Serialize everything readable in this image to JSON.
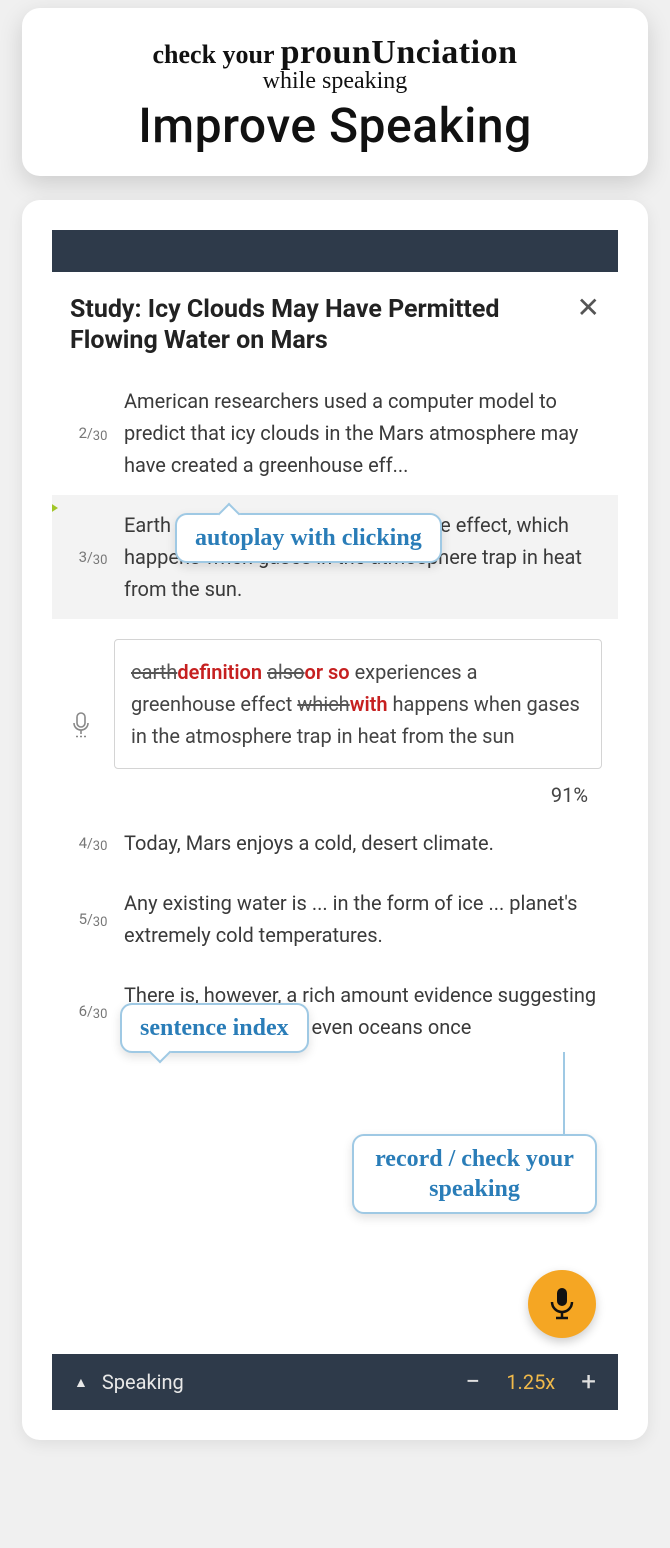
{
  "promo": {
    "line1_a": "check your",
    "line1_b": "prounUnciation",
    "line2": "while speaking",
    "line3": "Improve Speaking"
  },
  "article": {
    "title": "Study: Icy Clouds May Have Permitted Flowing Water on Mars",
    "total": "30",
    "sentences": [
      {
        "idx": "2",
        "text": "American researchers used a computer model to predict that icy clouds in the Mars atmosphere may have created a greenhouse eff..."
      },
      {
        "idx": "3",
        "text": "Earth also experiences a greenhouse effect, which happens when gases in the atmosphere trap in heat from the sun."
      },
      {
        "idx": "4",
        "text": "Today, Mars enjoys a cold, desert climate."
      },
      {
        "idx": "5",
        "text": "Any existing water is ... in the form of ice ... planet's extremely cold temperatures."
      },
      {
        "idx": "6",
        "text": "There is, however, a rich amount evidence suggesting that rivers, lakes and even oceans once"
      }
    ],
    "result": {
      "s1_strike": "earth",
      "s1_corr": "definition",
      "s2_strike": "also",
      "s2_corr": "or so",
      "mid1": " experiences a greenhouse effect ",
      "s3_strike": "which",
      "s3_corr": "with",
      "tail": " happens when gases in the atmosphere trap in heat from the sun",
      "score": "91%"
    }
  },
  "bottom": {
    "mode": "Speaking",
    "speed": "1.25x",
    "minus": "−",
    "plus": "+"
  },
  "callouts": {
    "autoplay": "autoplay with clicking",
    "index": "sentence index",
    "record": "record / check your speaking"
  }
}
